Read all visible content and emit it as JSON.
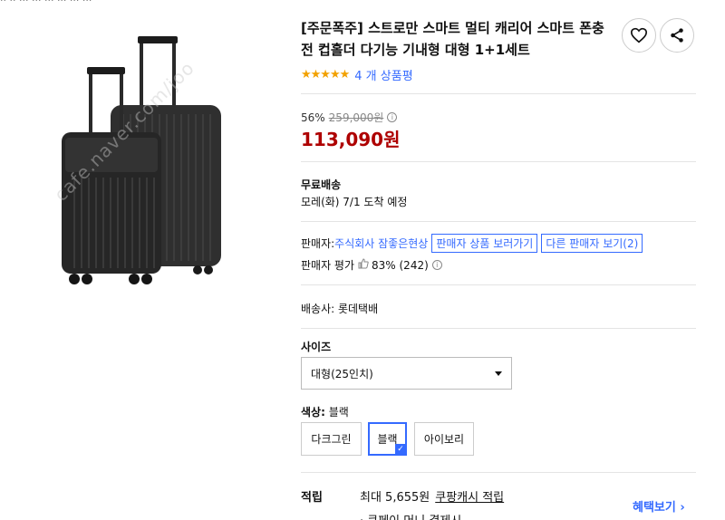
{
  "breadcrumb": "·· ·· ··· ··· ··· ··· ··· ···",
  "product": {
    "title": "[주문폭주] 스트로만 스마트 멀티 캐리어 스마트 폰충전 컵홀더 다기능 기내형 대형 1+1세트",
    "rating_stars": "★★★★★",
    "rating_value": 5,
    "review_count": "4 개 상품평",
    "watermark": "cafe.naver.com/joo"
  },
  "icons": {
    "wishlist": "heart-icon",
    "share": "share-icon"
  },
  "pricing": {
    "discount_rate": "56%",
    "original_price": "259,000원",
    "sale_price": "113,090원",
    "info_glyph": "i"
  },
  "shipping": {
    "label": "무료배송",
    "arrival": "모레(화) 7/1 도착 예정"
  },
  "seller": {
    "label": "판매자: ",
    "name": "주식회사 잠좋은현상",
    "products_button": "판매자 상품 보러가기",
    "other_sellers_button": "다른 판매자 보기(2)",
    "rating_label": "판매자 평가",
    "rating_value": "83% (242)"
  },
  "delivery": {
    "carrier": "배송사:  롯데택배"
  },
  "size": {
    "label": "사이즈",
    "selected": "대형(25인치)"
  },
  "color": {
    "label": "색상:",
    "selected_name": "블랙",
    "options": [
      "다크그린",
      "블랙",
      "아이보리"
    ]
  },
  "reward": {
    "label": "적립",
    "text": "최대 5,655원",
    "link": "쿠팡캐시 적립",
    "sub": "· 쿠페이 머니 결제시",
    "benefit_link": "혜택보기 ›"
  },
  "colors": {
    "accent": "#346aff",
    "price_red": "#ae0000",
    "star": "#f2a100"
  }
}
